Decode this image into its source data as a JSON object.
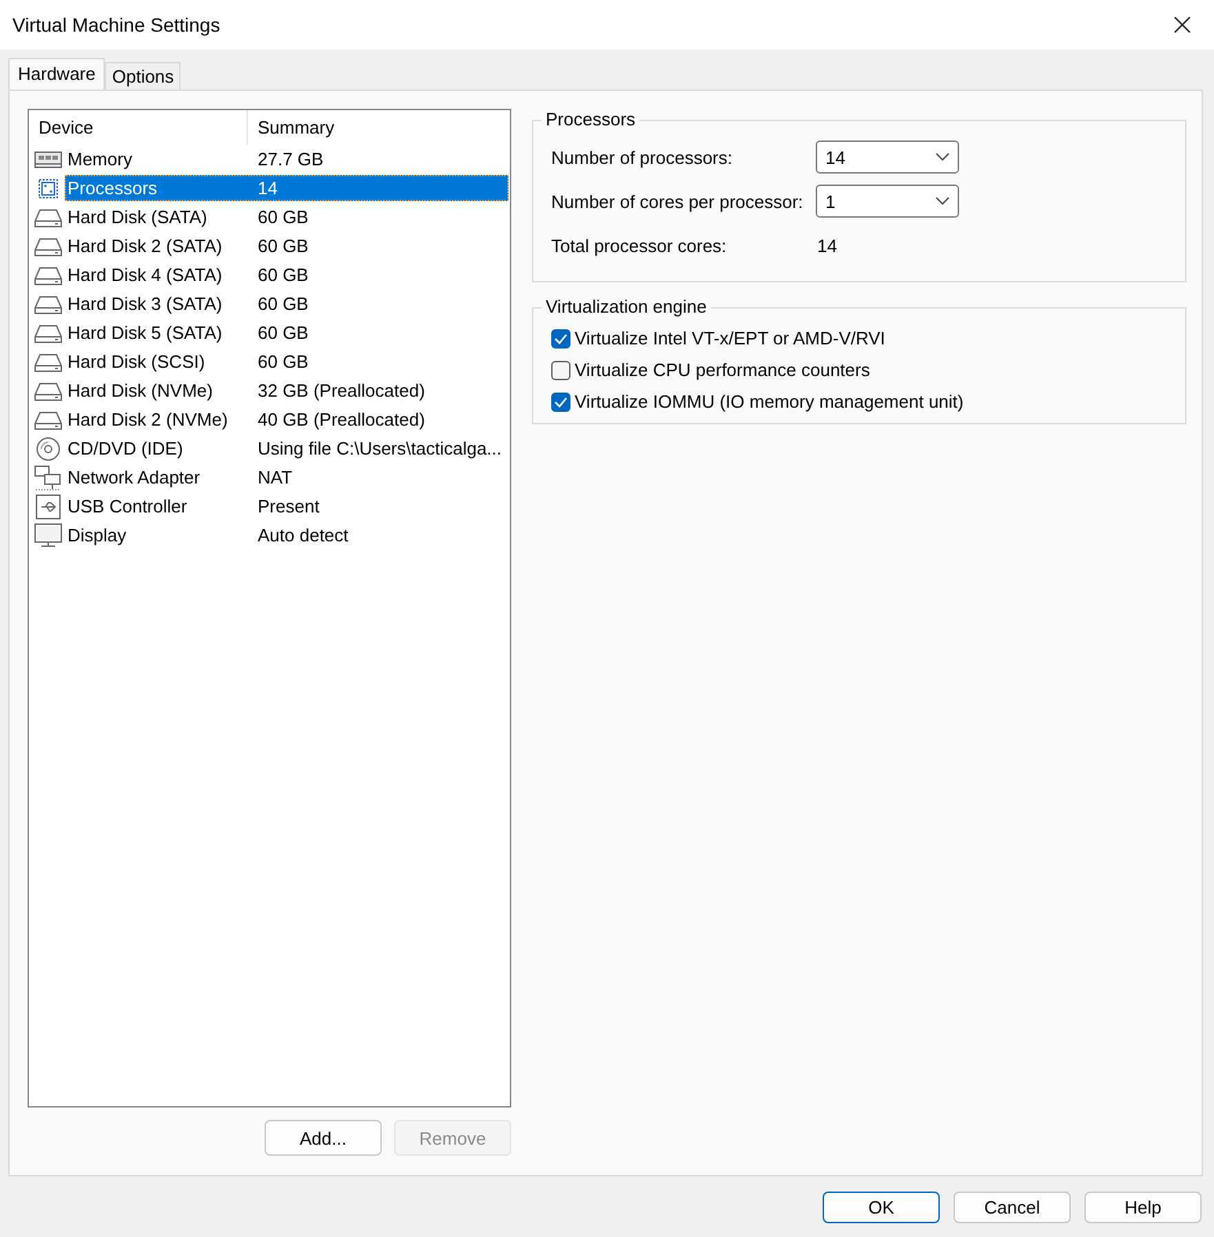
{
  "window": {
    "title": "Virtual Machine Settings"
  },
  "tabs": [
    {
      "label": "Hardware",
      "selected": true
    },
    {
      "label": "Options",
      "selected": false
    }
  ],
  "device_list": {
    "columns": [
      "Device",
      "Summary"
    ],
    "rows": [
      {
        "kind": "memory",
        "device": "Memory",
        "summary": "27.7 GB",
        "selected": false
      },
      {
        "kind": "processor",
        "device": "Processors",
        "summary": "14",
        "selected": true
      },
      {
        "kind": "disk",
        "device": "Hard Disk (SATA)",
        "summary": "60 GB",
        "selected": false
      },
      {
        "kind": "disk",
        "device": "Hard Disk 2 (SATA)",
        "summary": "60 GB",
        "selected": false
      },
      {
        "kind": "disk",
        "device": "Hard Disk 4 (SATA)",
        "summary": "60 GB",
        "selected": false
      },
      {
        "kind": "disk",
        "device": "Hard Disk 3 (SATA)",
        "summary": "60 GB",
        "selected": false
      },
      {
        "kind": "disk",
        "device": "Hard Disk 5 (SATA)",
        "summary": "60 GB",
        "selected": false
      },
      {
        "kind": "disk",
        "device": "Hard Disk (SCSI)",
        "summary": "60 GB",
        "selected": false
      },
      {
        "kind": "disk",
        "device": "Hard Disk (NVMe)",
        "summary": "32 GB (Preallocated)",
        "selected": false
      },
      {
        "kind": "disk",
        "device": "Hard Disk 2 (NVMe)",
        "summary": "40 GB (Preallocated)",
        "selected": false
      },
      {
        "kind": "cdrom",
        "device": "CD/DVD (IDE)",
        "summary": "Using file C:\\Users\\tacticalga...",
        "selected": false
      },
      {
        "kind": "network",
        "device": "Network Adapter",
        "summary": "NAT",
        "selected": false
      },
      {
        "kind": "usb",
        "device": "USB Controller",
        "summary": "Present",
        "selected": false
      },
      {
        "kind": "display",
        "device": "Display",
        "summary": "Auto detect",
        "selected": false
      }
    ]
  },
  "list_buttons": [
    {
      "label": "Add...",
      "disabled": false
    },
    {
      "label": "Remove",
      "disabled": true
    }
  ],
  "processors": {
    "title": "Processors",
    "fields": [
      {
        "kind": "dropdown",
        "label": "Number of processors:",
        "value": "14"
      },
      {
        "kind": "dropdown",
        "label": "Number of cores per processor:",
        "value": "1"
      },
      {
        "kind": "readout",
        "label": "Total processor cores:",
        "value": "14"
      }
    ]
  },
  "virtualization": {
    "title": "Virtualization engine",
    "options": [
      {
        "label": "Virtualize Intel VT-x/EPT or AMD-V/RVI",
        "checked": true
      },
      {
        "label": "Virtualize CPU performance counters",
        "checked": false
      },
      {
        "label": "Virtualize IOMMU (IO memory management unit)",
        "checked": true
      }
    ]
  },
  "buttons": [
    {
      "label": "OK",
      "default": true
    },
    {
      "label": "Cancel",
      "default": false
    },
    {
      "label": "Help",
      "default": false
    }
  ]
}
